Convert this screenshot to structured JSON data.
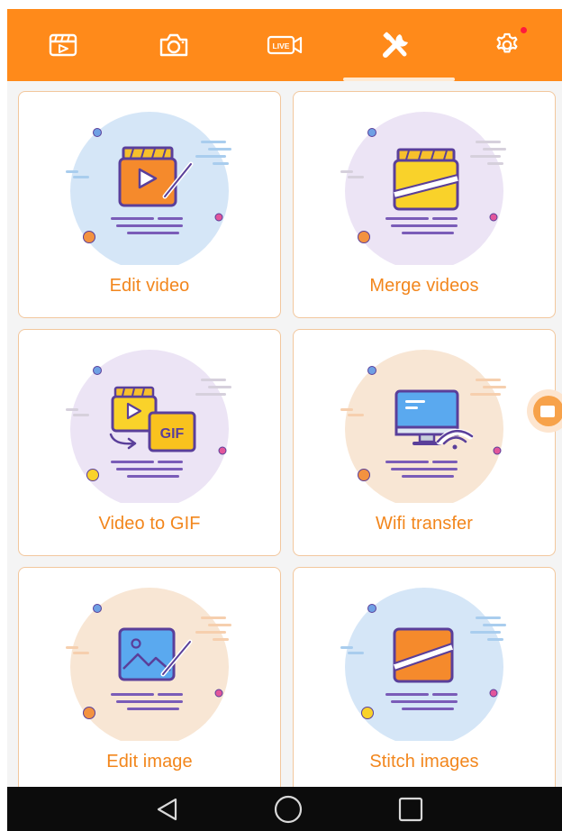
{
  "tabs": [
    {
      "icon": "video-clapper-icon",
      "active": false
    },
    {
      "icon": "camera-icon",
      "active": false
    },
    {
      "icon": "live-record-icon",
      "active": false
    },
    {
      "icon": "tools-icon",
      "active": true
    },
    {
      "icon": "settings-gear-icon",
      "active": false,
      "badge": true
    }
  ],
  "cards": [
    {
      "label": "Edit video",
      "icon": "edit-video-icon"
    },
    {
      "label": "Merge videos",
      "icon": "merge-videos-icon"
    },
    {
      "label": "Video to GIF",
      "icon": "video-to-gif-icon",
      "badge_text": "GIF"
    },
    {
      "label": "Wifi transfer",
      "icon": "wifi-transfer-icon"
    },
    {
      "label": "Edit image",
      "icon": "edit-image-icon"
    },
    {
      "label": "Stitch images",
      "icon": "stitch-images-icon"
    }
  ],
  "navigation": {
    "back": "back-triangle-icon",
    "home": "home-circle-icon",
    "recents": "recents-square-icon"
  },
  "colors": {
    "accent": "#ff8a1a",
    "label": "#f2861c",
    "card_border": "#f2c79d"
  }
}
